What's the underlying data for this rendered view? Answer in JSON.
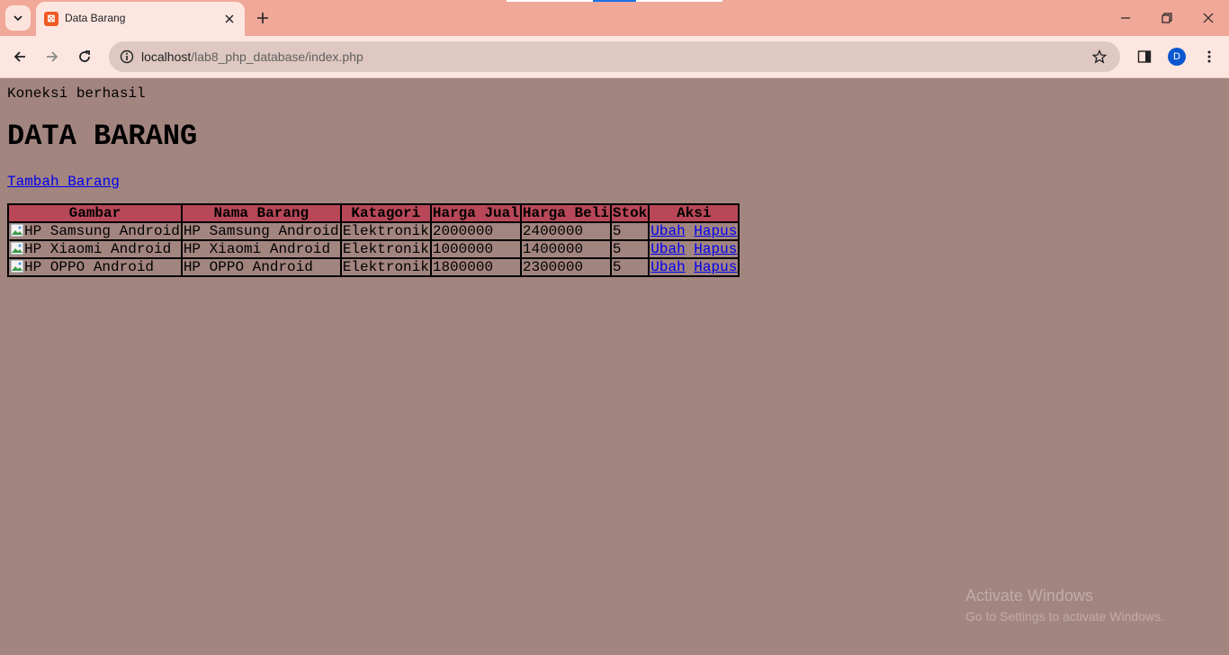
{
  "browser": {
    "tab_title": "Data Barang",
    "url_host": "localhost",
    "url_path": "/lab8_php_database/index.php",
    "profile_initial": "D"
  },
  "page": {
    "status": "Koneksi berhasil",
    "heading": "DATA BARANG",
    "add_link": "Tambah Barang",
    "table": {
      "headers": [
        "Gambar",
        "Nama Barang",
        "Katagori",
        "Harga Jual",
        "Harga Beli",
        "Stok",
        "Aksi"
      ],
      "rows": [
        {
          "gambar_alt": "HP Samsung Android",
          "nama": "HP Samsung Android",
          "kategori": "Elektronik",
          "harga_jual": "2000000",
          "harga_beli": "2400000",
          "stok": "5",
          "ubah": "Ubah",
          "hapus": "Hapus"
        },
        {
          "gambar_alt": "HP Xiaomi Android",
          "nama": "HP Xiaomi Android",
          "kategori": "Elektronik",
          "harga_jual": "1000000",
          "harga_beli": "1400000",
          "stok": "5",
          "ubah": "Ubah",
          "hapus": "Hapus"
        },
        {
          "gambar_alt": "HP OPPO Android",
          "nama": "HP OPPO Android",
          "kategori": "Elektronik",
          "harga_jual": "1800000",
          "harga_beli": "2300000",
          "stok": "5",
          "ubah": "Ubah",
          "hapus": "Hapus"
        }
      ]
    }
  },
  "watermark": {
    "title": "Activate Windows",
    "subtitle": "Go to Settings to activate Windows."
  },
  "colors": {
    "page_bg": "#a38580",
    "header_cell_bg": "#b84858",
    "tabbar_bg": "#f0a898",
    "link": "#0000ee"
  }
}
